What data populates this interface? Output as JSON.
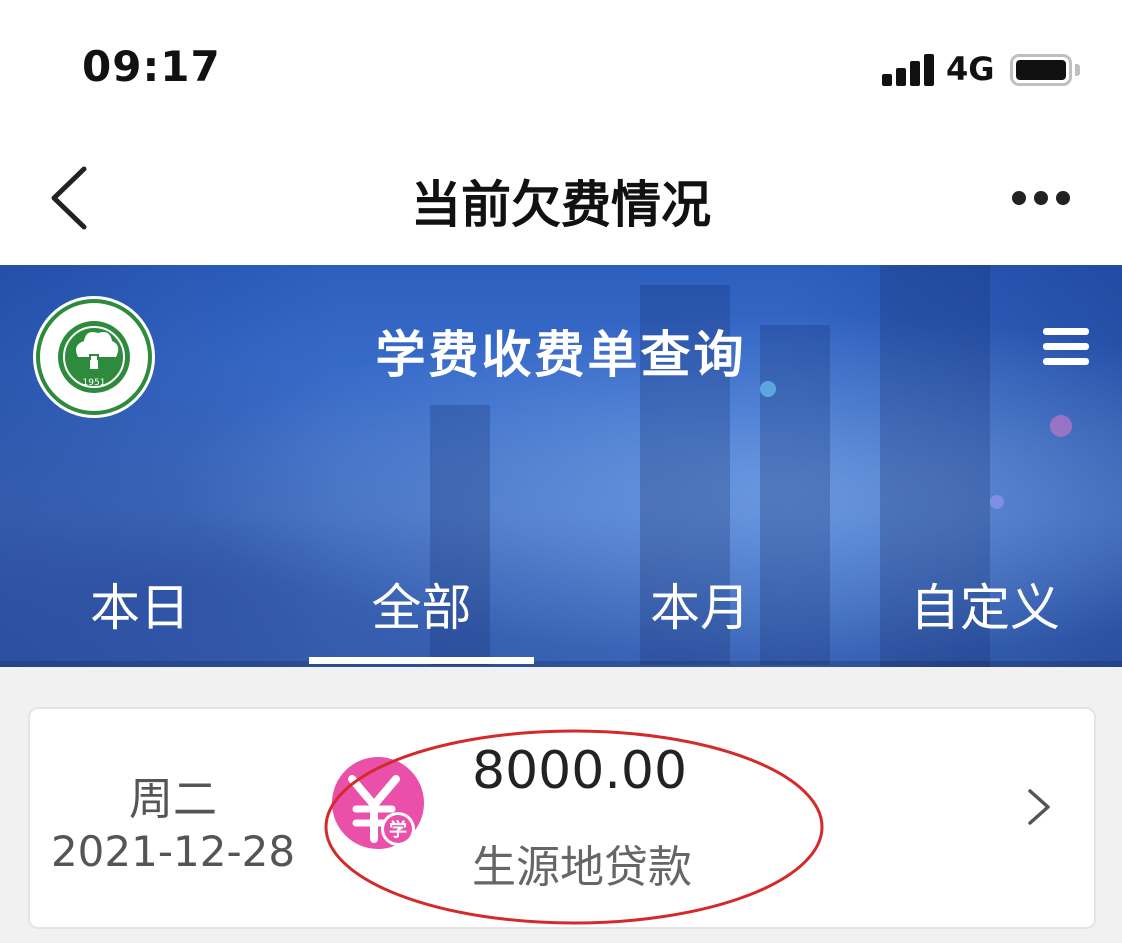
{
  "status": {
    "time": "09:17",
    "network": "4G"
  },
  "nav": {
    "title": "当前欠费情况"
  },
  "banner": {
    "title": "学费收费单查询",
    "logo_caption": "1951"
  },
  "tabs": [
    {
      "label": "本日",
      "active": false
    },
    {
      "label": "全部",
      "active": true
    },
    {
      "label": "本月",
      "active": false
    },
    {
      "label": "自定义",
      "active": false
    }
  ],
  "records": [
    {
      "weekday": "周二",
      "date": "2021-12-28",
      "amount": "8000.00",
      "type": "生源地贷款",
      "icon_badge": "学"
    }
  ],
  "colors": {
    "banner_blue": "#3b6fcc",
    "icon_pink": "#ea4fa9",
    "highlight_red": "#d42a2a",
    "logo_green": "#2e8b3e"
  },
  "icons": {
    "back": "chevron-left-icon",
    "more": "more-horizontal-icon",
    "menu": "hamburger-menu-icon",
    "payment": "yuan-icon",
    "arrow": "chevron-right-icon"
  }
}
